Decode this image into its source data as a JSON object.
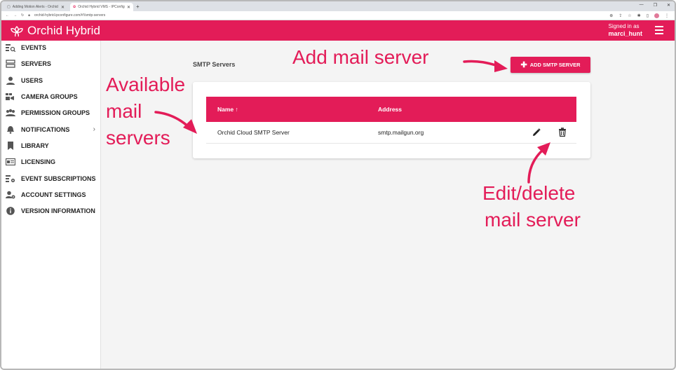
{
  "browser": {
    "tabs": [
      {
        "title": "Adding Motion Alerts - Orchid H",
        "active": false
      },
      {
        "title": "Orchid Hybrid VMS - IPConfigure",
        "active": true
      }
    ],
    "url": "orchid-hybrid.ipconfigure.com/#!/smtp-servers"
  },
  "header": {
    "app_name": "Orchid Hybrid",
    "signed_in_label": "Signed in as",
    "username": "marci_hunt"
  },
  "sidebar": {
    "items": [
      {
        "label": "EVENTS",
        "icon": "events-icon"
      },
      {
        "label": "SERVERS",
        "icon": "servers-icon"
      },
      {
        "label": "USERS",
        "icon": "user-icon"
      },
      {
        "label": "CAMERA GROUPS",
        "icon": "camera-groups-icon"
      },
      {
        "label": "PERMISSION GROUPS",
        "icon": "permission-groups-icon"
      },
      {
        "label": "NOTIFICATIONS",
        "icon": "bell-icon"
      },
      {
        "label": "LIBRARY",
        "icon": "bookmark-icon"
      },
      {
        "label": "LICENSING",
        "icon": "license-icon"
      },
      {
        "label": "EVENT SUBSCRIPTIONS",
        "icon": "event-subscriptions-icon"
      },
      {
        "label": "ACCOUNT SETTINGS",
        "icon": "account-settings-icon"
      },
      {
        "label": "VERSION INFORMATION",
        "icon": "info-icon"
      }
    ]
  },
  "main": {
    "section_title": "SMTP Servers",
    "add_button_label": "ADD SMTP SERVER",
    "table": {
      "columns": [
        "Name ↑",
        "Address"
      ],
      "rows": [
        {
          "name": "Orchid Cloud SMTP Server",
          "address": "smtp.mailgun.org"
        }
      ]
    }
  },
  "annotations": {
    "add": "Add mail server",
    "available": [
      "Available",
      "mail",
      "servers"
    ],
    "edit_delete": [
      "Edit/delete",
      "mail server"
    ]
  },
  "colors": {
    "brand": "#e31c58",
    "background": "#f4f4f4"
  }
}
